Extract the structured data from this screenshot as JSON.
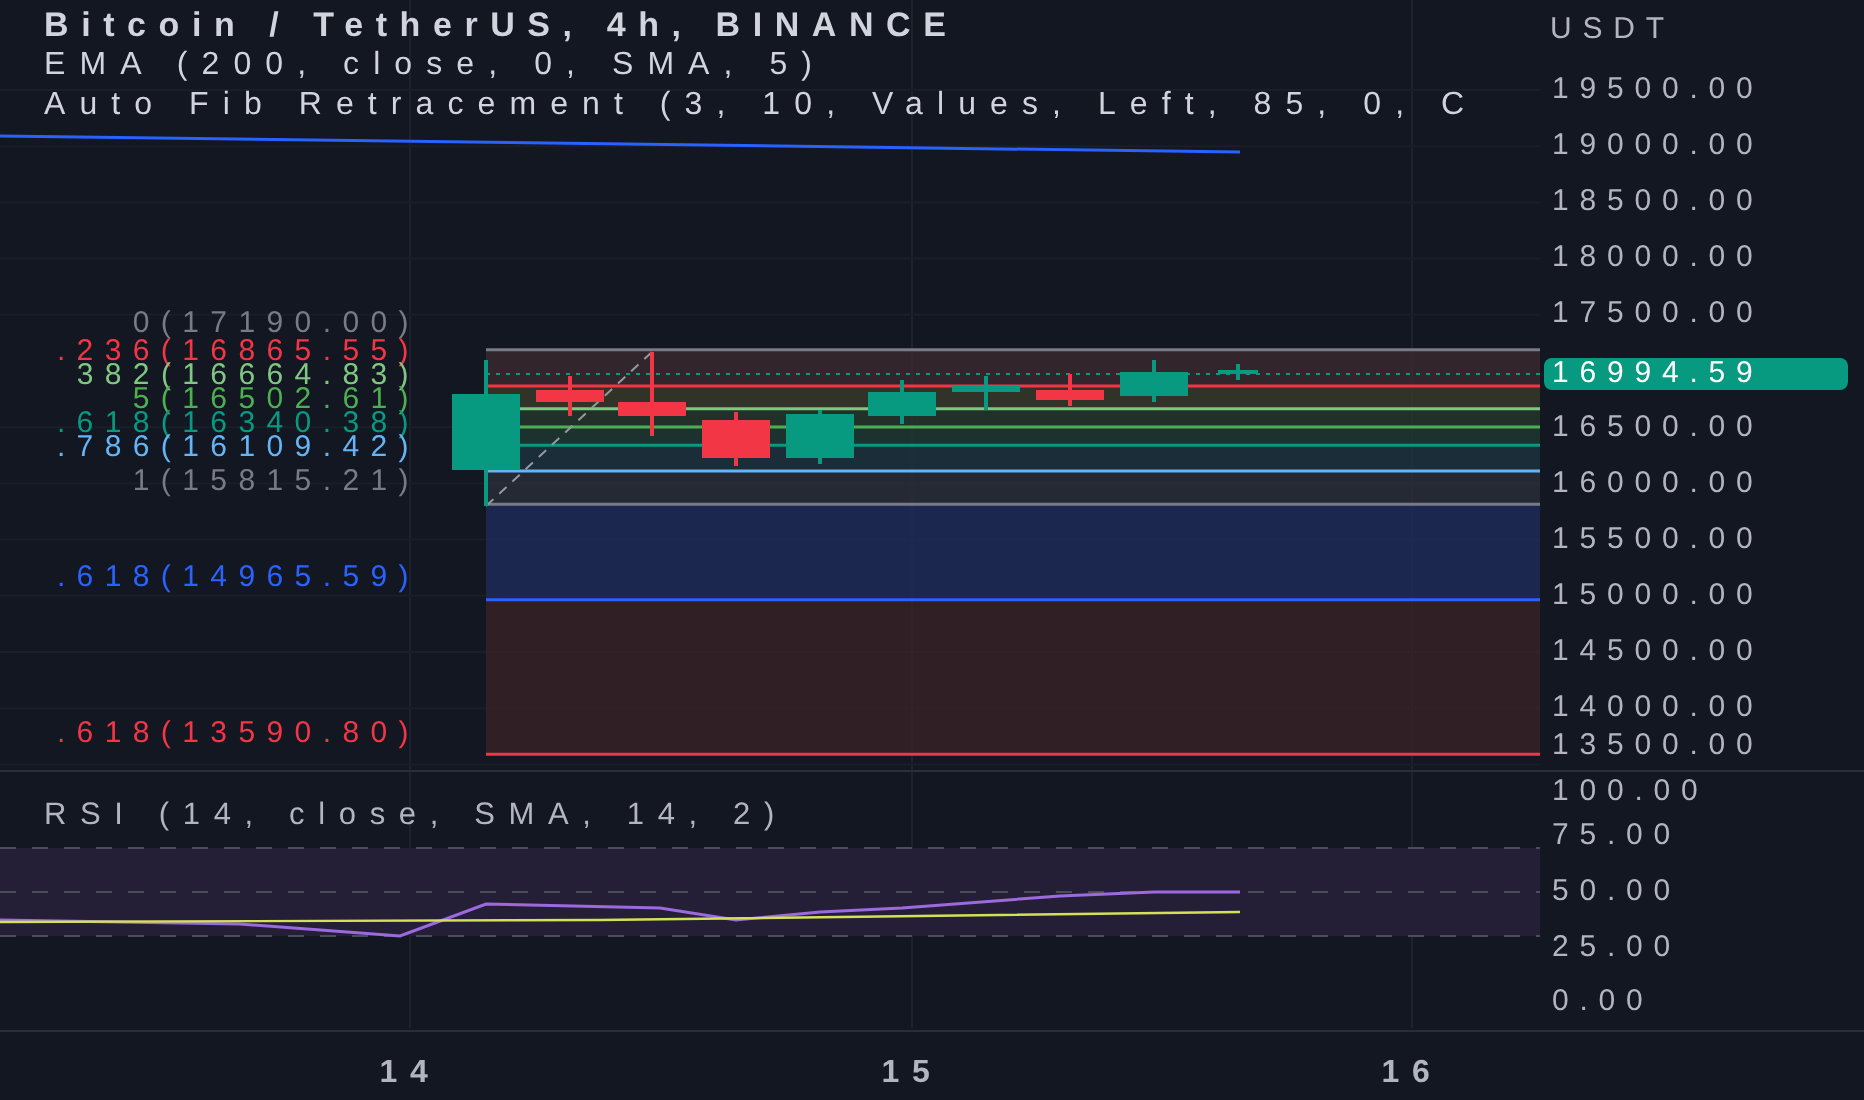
{
  "legend": {
    "symbol": "Bitcoin / TetherUS, 4h, BINANCE",
    "indicators": [
      "EMA (200, close, 0, SMA, 5)",
      "Auto Fib Retracement (3, 10, Values, Left, 85, 0, C"
    ]
  },
  "price_axis": {
    "currency": "USDT",
    "ticks": [
      "19500.00",
      "19000.00",
      "18500.00",
      "18000.00",
      "17500.00",
      "16500.00",
      "16000.00",
      "15500.00",
      "15000.00",
      "14500.00",
      "14000.00",
      "13500.00"
    ],
    "last_price": "16994.59"
  },
  "fib_levels": [
    {
      "label": "0(17190.00)",
      "color": "#787b86"
    },
    {
      "label": ".236(16865.55)",
      "color": "#f23645"
    },
    {
      "label": "382(16664.83)",
      "color": "#81c784"
    },
    {
      "label": "5(16502.61)",
      "color": "#4caf50"
    },
    {
      "label": ".618(16340.38)",
      "color": "#089981"
    },
    {
      "label": ".786(16109.42)",
      "color": "#64b5f6"
    },
    {
      "label": "1(15815.21)",
      "color": "#787b86"
    },
    {
      "label": ".618(14965.59)",
      "color": "#2962ff"
    },
    {
      "label": ".618(13590.80)",
      "color": "#f23645"
    }
  ],
  "rsi": {
    "title": "RSI (14, close, SMA, 14, 2)",
    "ticks": [
      "100.00",
      "75.00",
      "50.00",
      "25.00",
      "0.00"
    ]
  },
  "time_axis": [
    "14",
    "15",
    "16"
  ]
}
